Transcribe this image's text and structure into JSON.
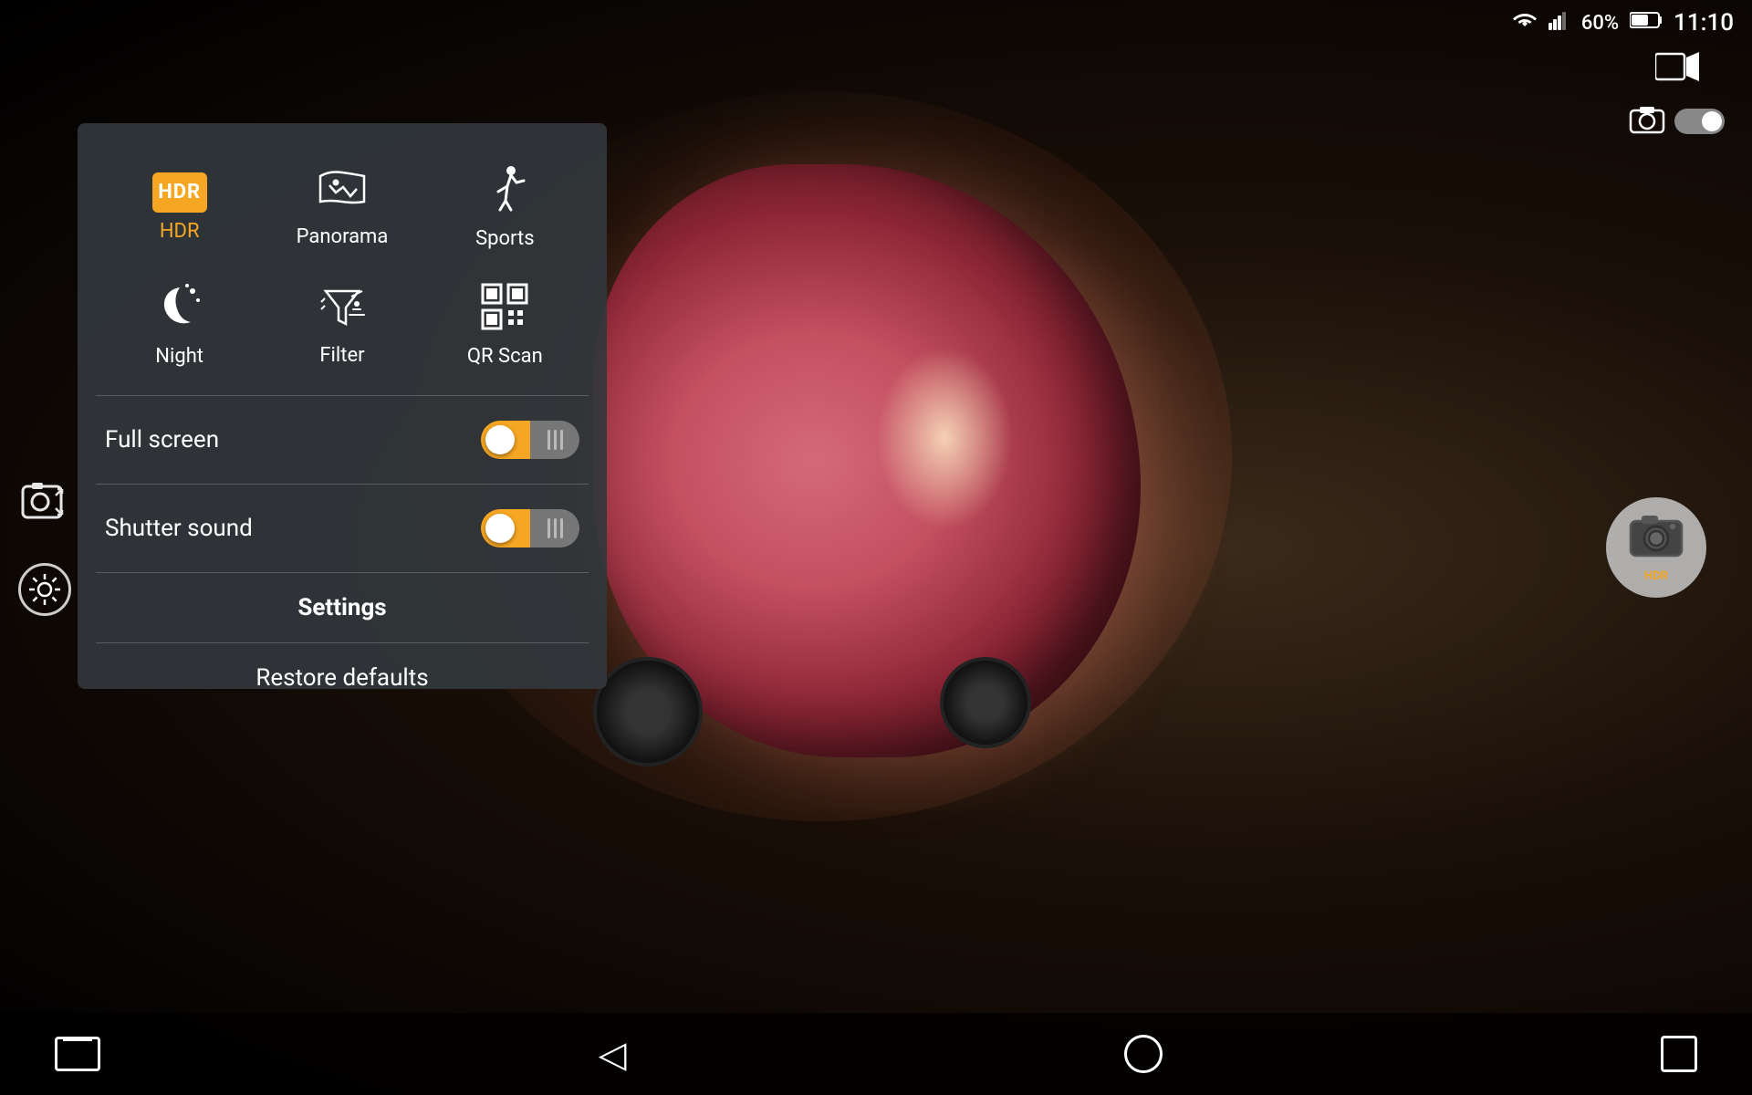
{
  "statusBar": {
    "battery": "60%",
    "time": "11:10",
    "wifiIcon": "wifi",
    "signalIcon": "signal",
    "batteryIcon": "battery"
  },
  "modes": [
    {
      "id": "hdr",
      "label": "HDR",
      "active": true
    },
    {
      "id": "panorama",
      "label": "Panorama",
      "active": false
    },
    {
      "id": "sports",
      "label": "Sports",
      "active": false
    },
    {
      "id": "night",
      "label": "Night",
      "active": false
    },
    {
      "id": "filter",
      "label": "Filter",
      "active": false
    },
    {
      "id": "qrscan",
      "label": "QR Scan",
      "active": false
    }
  ],
  "toggles": [
    {
      "id": "fullscreen",
      "label": "Full screen",
      "on": true
    },
    {
      "id": "shuttersound",
      "label": "Shutter sound",
      "on": true
    }
  ],
  "buttons": {
    "settings": "Settings",
    "restoreDefaults": "Restore defaults"
  },
  "navigation": {
    "back": "◁",
    "home": "○",
    "overview": "□"
  },
  "colors": {
    "accent": "#f5a623",
    "panelBg": "rgba(50,55,60,0.92)",
    "white": "#ffffff"
  }
}
